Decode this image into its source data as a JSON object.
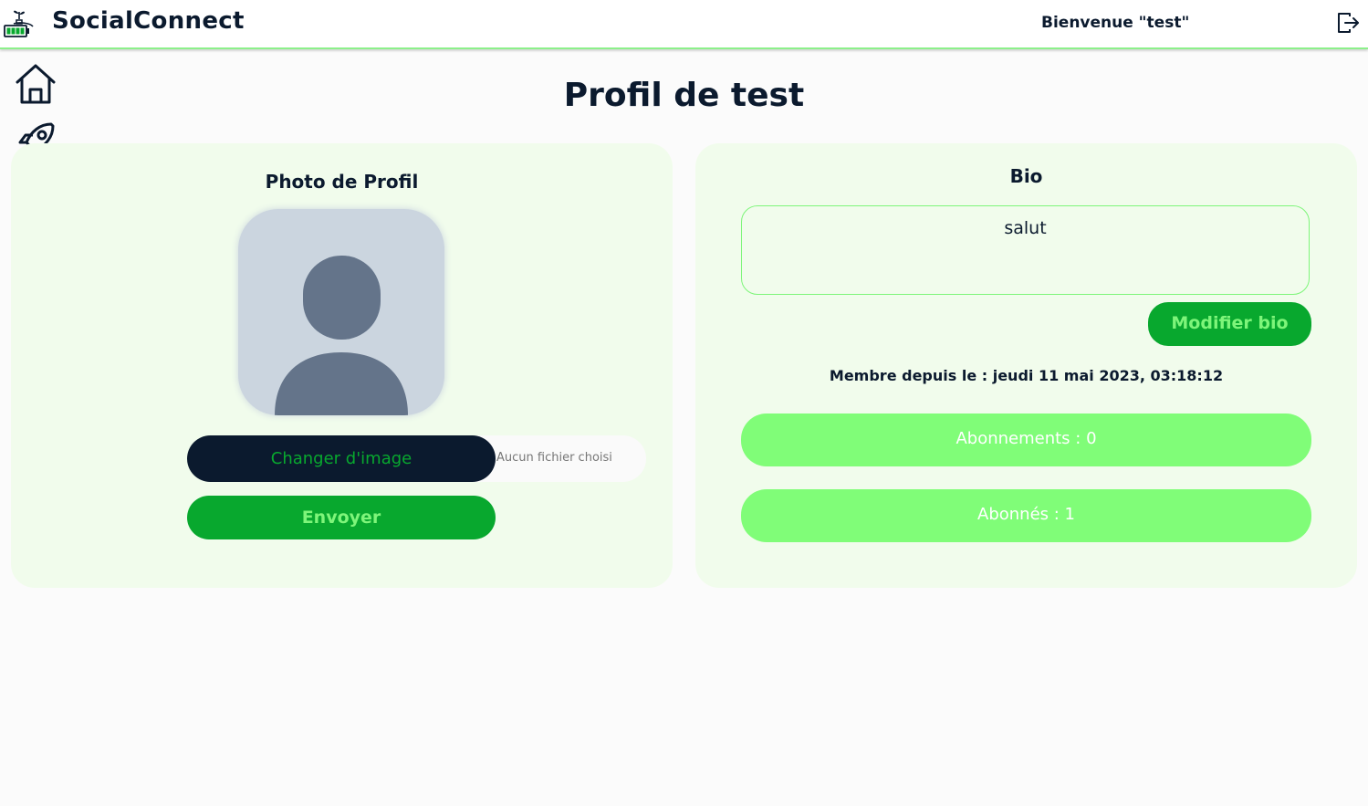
{
  "app": {
    "name": "SocialConnect",
    "welcome": "Bienvenue \"test\""
  },
  "icons": {
    "logo": "plant-battery-icon",
    "logout": "logout-icon",
    "home": "home-icon",
    "explore": "rocket-icon",
    "profile": "user-icon"
  },
  "page": {
    "title": "Profil de test"
  },
  "photo_card": {
    "heading": "Photo de Profil",
    "change_button": "Changer d'image",
    "file_status": "Aucun fichier choisi",
    "send_button": "Envoyer"
  },
  "bio_card": {
    "heading": "Bio",
    "bio_text": "salut",
    "edit_button": "Modifier bio",
    "member_since": "Membre depuis le : jeudi 11 mai 2023, 03:18:12",
    "following_button": "Abonnements : 0",
    "followers_button": "Abonnés : 1"
  },
  "colors": {
    "navy": "#0b1a2e",
    "green_dark": "#08a82e",
    "green_light": "#80fd78",
    "card_bg": "#f1fcec",
    "avatar_bg": "#cbd5df",
    "avatar_fg": "#64748a"
  }
}
